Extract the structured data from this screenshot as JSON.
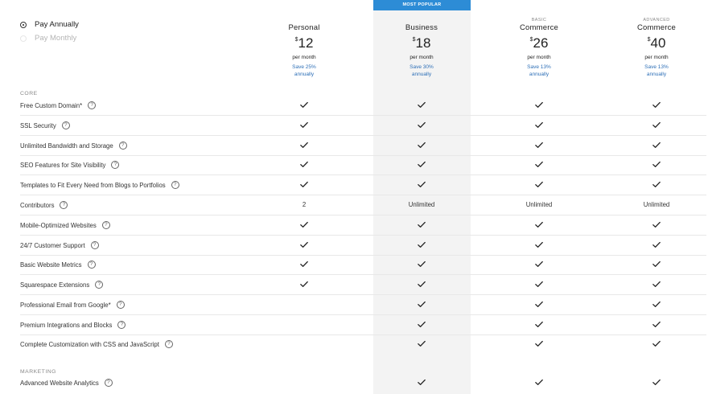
{
  "billing_toggle": {
    "annual_label": "Pay Annually",
    "monthly_label": "Pay Monthly",
    "selected": "annual"
  },
  "popular_badge": "MOST POPULAR",
  "plans": [
    {
      "kicker": "",
      "name": "Personal",
      "currency": "$",
      "price": "12",
      "per": "per month",
      "save_line1": "Save 25%",
      "save_line2": "annually"
    },
    {
      "kicker": "",
      "name": "Business",
      "currency": "$",
      "price": "18",
      "per": "per month",
      "save_line1": "Save 30%",
      "save_line2": "annually"
    },
    {
      "kicker": "BASIC",
      "name": "Commerce",
      "currency": "$",
      "price": "26",
      "per": "per month",
      "save_line1": "Save 13%",
      "save_line2": "annually"
    },
    {
      "kicker": "ADVANCED",
      "name": "Commerce",
      "currency": "$",
      "price": "40",
      "per": "per month",
      "save_line1": "Save 13%",
      "save_line2": "annually"
    }
  ],
  "sections": [
    {
      "label": "CORE"
    },
    {
      "label": "MARKETING"
    }
  ],
  "features": [
    {
      "label": "Free Custom Domain*",
      "values": [
        "check",
        "check",
        "check",
        "check"
      ]
    },
    {
      "label": "SSL Security",
      "values": [
        "check",
        "check",
        "check",
        "check"
      ]
    },
    {
      "label": "Unlimited Bandwidth and Storage",
      "values": [
        "check",
        "check",
        "check",
        "check"
      ]
    },
    {
      "label": "SEO Features for Site Visibility",
      "values": [
        "check",
        "check",
        "check",
        "check"
      ]
    },
    {
      "label": "Templates to Fit Every Need from Blogs to Portfolios",
      "values": [
        "check",
        "check",
        "check",
        "check"
      ]
    },
    {
      "label": "Contributors",
      "values": [
        "2",
        "Unlimited",
        "Unlimited",
        "Unlimited"
      ]
    },
    {
      "label": "Mobile-Optimized Websites",
      "values": [
        "check",
        "check",
        "check",
        "check"
      ]
    },
    {
      "label": "24/7 Customer Support",
      "values": [
        "check",
        "check",
        "check",
        "check"
      ]
    },
    {
      "label": "Basic Website Metrics",
      "values": [
        "check",
        "check",
        "check",
        "check"
      ]
    },
    {
      "label": "Squarespace Extensions",
      "values": [
        "check",
        "check",
        "check",
        "check"
      ]
    },
    {
      "label": "Professional Email from Google*",
      "values": [
        "",
        "check",
        "check",
        "check"
      ]
    },
    {
      "label": "Premium Integrations and Blocks",
      "values": [
        "",
        "check",
        "check",
        "check"
      ]
    },
    {
      "label": "Complete Customization with CSS and JavaScript",
      "values": [
        "",
        "check",
        "check",
        "check"
      ]
    },
    {
      "label": "Advanced Website Analytics",
      "values": [
        "",
        "check",
        "check",
        "check"
      ]
    }
  ],
  "help_glyph": "?",
  "icons": {
    "check": "check-icon",
    "help": "question-circle-icon"
  }
}
